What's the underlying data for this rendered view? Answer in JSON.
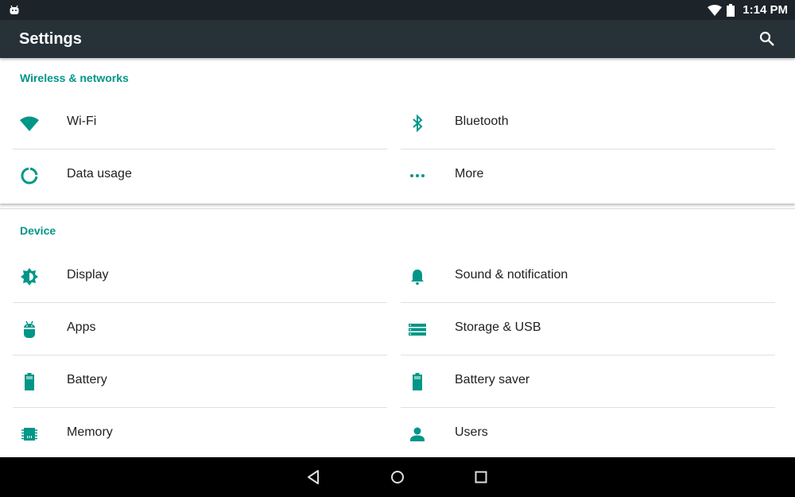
{
  "status_bar": {
    "left_icon": "android-notification-icon",
    "wifi_icon": "wifi-signal-icon",
    "battery_icon": "battery-icon",
    "time": "1:14 PM"
  },
  "app_bar": {
    "title": "Settings",
    "search_icon": "search-icon"
  },
  "colors": {
    "accent": "#009688",
    "app_bar": "#263238",
    "status_bar": "#1c2429"
  },
  "sections": [
    {
      "title": "Wireless & networks",
      "items": [
        {
          "label": "Wi-Fi",
          "icon": "wifi-icon"
        },
        {
          "label": "Bluetooth",
          "icon": "bluetooth-icon"
        },
        {
          "label": "Data usage",
          "icon": "data-usage-icon"
        },
        {
          "label": "More",
          "icon": "more-dots-icon"
        }
      ]
    },
    {
      "title": "Device",
      "items": [
        {
          "label": "Display",
          "icon": "brightness-icon"
        },
        {
          "label": "Sound & notification",
          "icon": "bell-icon"
        },
        {
          "label": "Apps",
          "icon": "android-icon"
        },
        {
          "label": "Storage & USB",
          "icon": "storage-icon"
        },
        {
          "label": "Battery",
          "icon": "battery-icon"
        },
        {
          "label": "Battery saver",
          "icon": "battery-saver-icon"
        },
        {
          "label": "Memory",
          "icon": "memory-chip-icon"
        },
        {
          "label": "Users",
          "icon": "person-icon"
        }
      ]
    }
  ],
  "nav_bar": {
    "back": "back-icon",
    "home": "home-icon",
    "recents": "recents-icon"
  }
}
